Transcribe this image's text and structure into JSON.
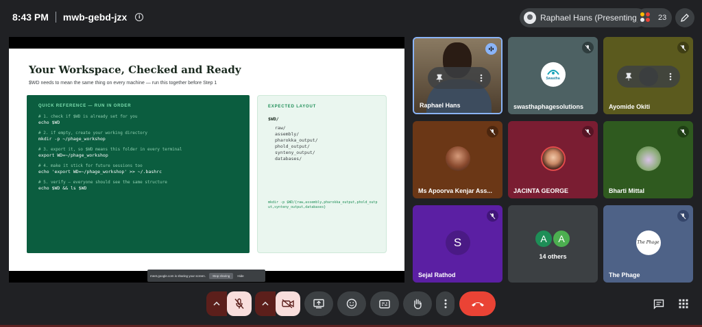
{
  "meeting": {
    "time": "8:43 PM",
    "code": "mwb-gebd-jzx"
  },
  "presenter_chip": {
    "label": "Raphael Hans (Presenting)"
  },
  "participants_count": "23",
  "slide": {
    "title": "Your Workspace, Checked and Ready",
    "subtitle": "$WD needs to mean the same thing on every machine — run this together before Step 1",
    "reference": {
      "title": "QUICK REFERENCE — RUN IN ORDER",
      "steps": [
        {
          "comment": "# 1. check if $WD is already set for you",
          "command": "echo $WD"
        },
        {
          "comment": "# 2. if empty, create your working directory",
          "command": "mkdir -p ~/phage_workshop"
        },
        {
          "comment": "# 3. export it, so $WD means this folder in every terminal",
          "command": "export WD=~/phage_workshop"
        },
        {
          "comment": "# 4. make it stick for future sessions too",
          "command": "echo 'export WD=~/phage_workshop' >> ~/.bashrc"
        },
        {
          "comment": "# 5. verify — everyone should see the same structure",
          "command": "echo $WD && ls $WD"
        }
      ]
    },
    "layout": {
      "title": "EXPECTED LAYOUT",
      "root": "$WD/",
      "dirs": [
        "raw/",
        "assembly/",
        "pharokka_output/",
        "phold_output/",
        "synteny_output/",
        "databases/"
      ],
      "command": "mkdir -p $WD/{raw,assembly,pharokka_output,phold_output,synteny_output,databases}"
    }
  },
  "share_bar": {
    "text": "meet.google.com is sharing your screen.",
    "stop_label": "Stop sharing",
    "hide_label": "Hide"
  },
  "tiles": [
    {
      "name": "Raphael Hans",
      "bg": "#5d4a36",
      "status": "speaking"
    },
    {
      "name": "swasthaphagesolutions",
      "bg": "#4d6163",
      "status": "muted",
      "logo_text": "Swastha"
    },
    {
      "name": "Ayomide Okiti",
      "bg": "#5b5a1e",
      "status": "muted"
    },
    {
      "name": "Ms Apoorva Kenjar Ass...",
      "bg": "#6b3716",
      "status": "muted"
    },
    {
      "name": "JACINTA GEORGE",
      "bg": "#7a1d32",
      "status": "muted"
    },
    {
      "name": "Bharti Mittal",
      "bg": "#2f5a1f",
      "status": "muted"
    },
    {
      "name": "Sejal Rathod",
      "bg": "#5b1fa3",
      "status": "muted",
      "initial": "S"
    },
    {
      "name": "14 others",
      "bg": "#3c4043",
      "status": "none",
      "initials": [
        "A",
        "A"
      ]
    },
    {
      "name": "The Phage",
      "bg": "#4e6287",
      "status": "muted",
      "logo_text": "The Phage"
    }
  ],
  "colors": {
    "background": "#202124",
    "danger": "#ea4335",
    "muted_red": "#5c1f1b"
  }
}
